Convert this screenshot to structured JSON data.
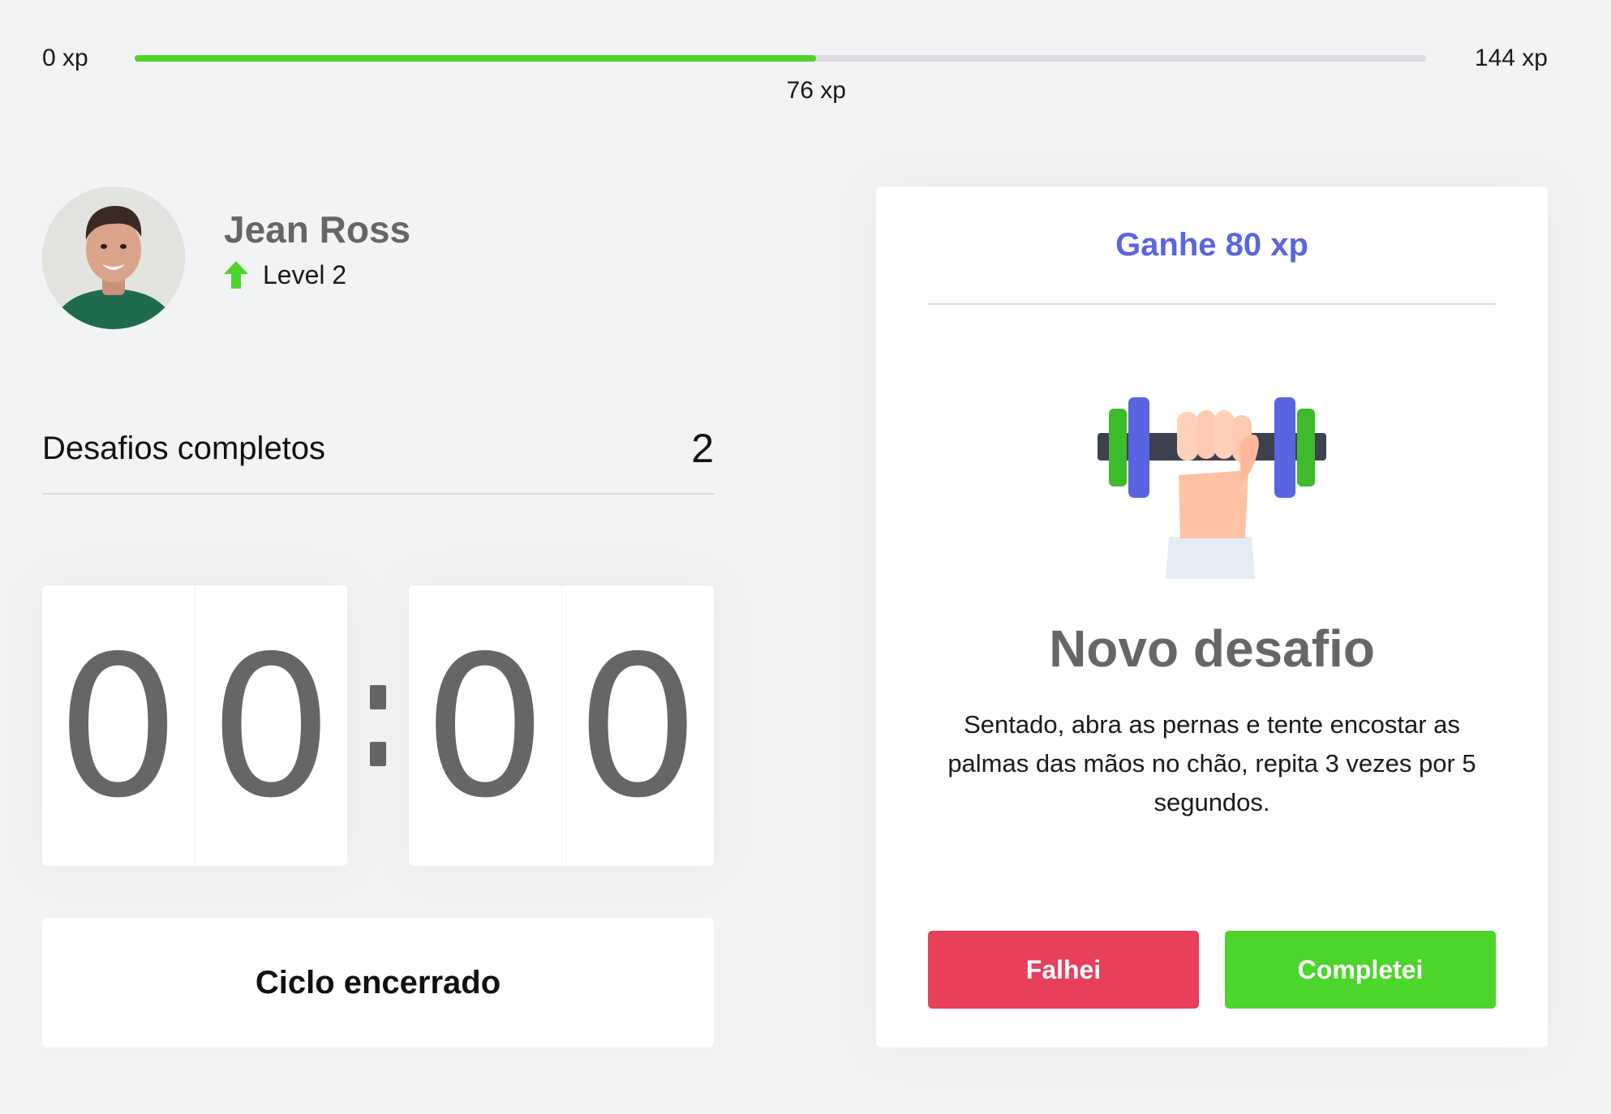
{
  "xp": {
    "min_label": "0 xp",
    "max_label": "144 xp",
    "current_label": "76 xp",
    "current": 76,
    "max": 144,
    "fill_color": "#4cd62b"
  },
  "profile": {
    "name": "Jean Ross",
    "level_label": "Level 2",
    "avatar_icon": "user-avatar",
    "level_icon": "arrow-up-icon"
  },
  "completed_challenges": {
    "label": "Desafios completos",
    "count": "2"
  },
  "countdown": {
    "minute_left": "0",
    "minute_right": "0",
    "second_left": "0",
    "second_right": "0"
  },
  "cycle_button_label": "Ciclo encerrado",
  "challenge": {
    "reward": "Ganhe 80 xp",
    "icon": "dumbbell-icon",
    "title": "Novo desafio",
    "description": "Sentado, abra as pernas e tente encostar as palmas das mãos no chão, repita 3 vezes por 5 segundos.",
    "fail_label": "Falhei",
    "success_label": "Completei"
  },
  "colors": {
    "accent_blue": "#5965e0",
    "red": "#e83f5b",
    "green": "#4cd62b",
    "text_gray": "#666666",
    "background": "#f2f3f5"
  }
}
